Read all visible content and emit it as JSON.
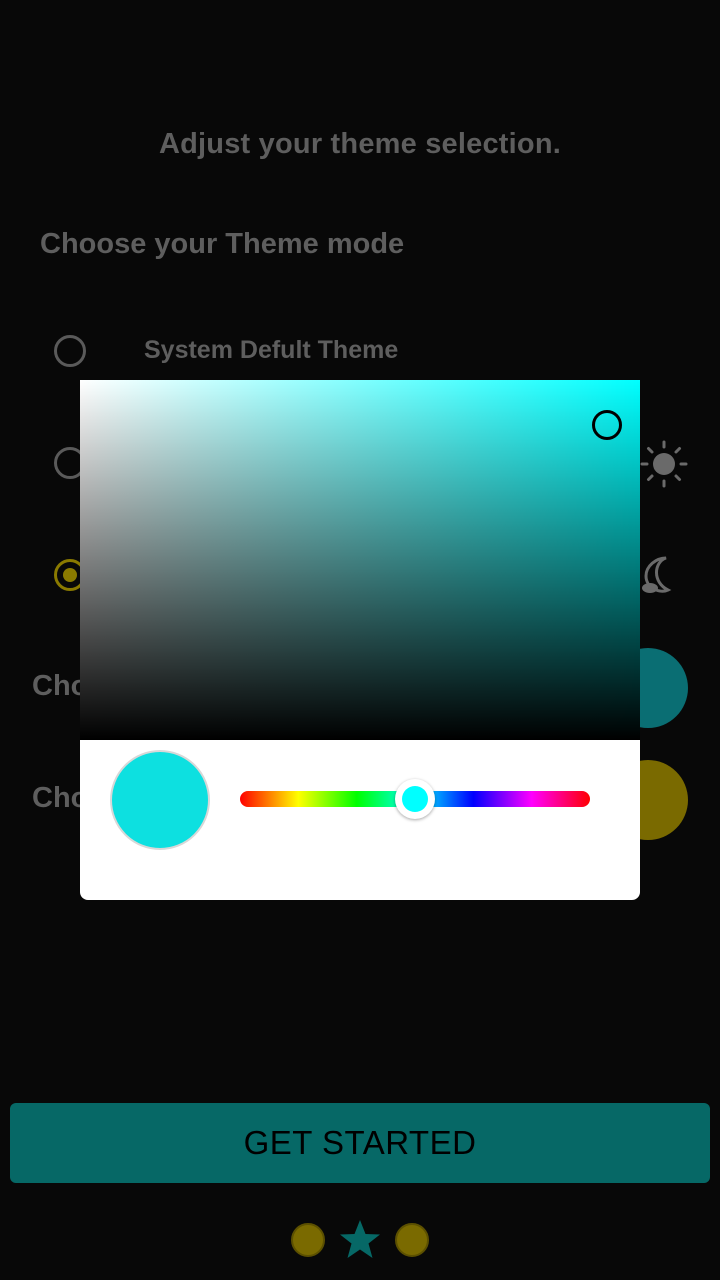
{
  "header": {
    "title": "Adjust your theme selection."
  },
  "theme_mode": {
    "title": "Choose your Theme mode",
    "options": [
      {
        "label": "System Defult Theme",
        "selected": false
      },
      {
        "label": "",
        "selected": false
      },
      {
        "label": "",
        "selected": true
      }
    ]
  },
  "color_rows": [
    {
      "label_partial": "Cho",
      "swatch_color": "#0a6e73"
    },
    {
      "label_partial": "Cho",
      "swatch_color": "#7a6a00"
    }
  ],
  "color_picker": {
    "selected_color": "#0de0e0",
    "hue_color": "#00ffff",
    "hue_position": 0.5
  },
  "colors": {
    "background": "#080808",
    "accent_teal": "#066866",
    "accent_gold": "#8a7a00",
    "muted_text": "#5e5e5e"
  },
  "footer": {
    "cta_label": "GET STARTED",
    "pager": [
      "dot",
      "star-icon",
      "dot"
    ]
  }
}
